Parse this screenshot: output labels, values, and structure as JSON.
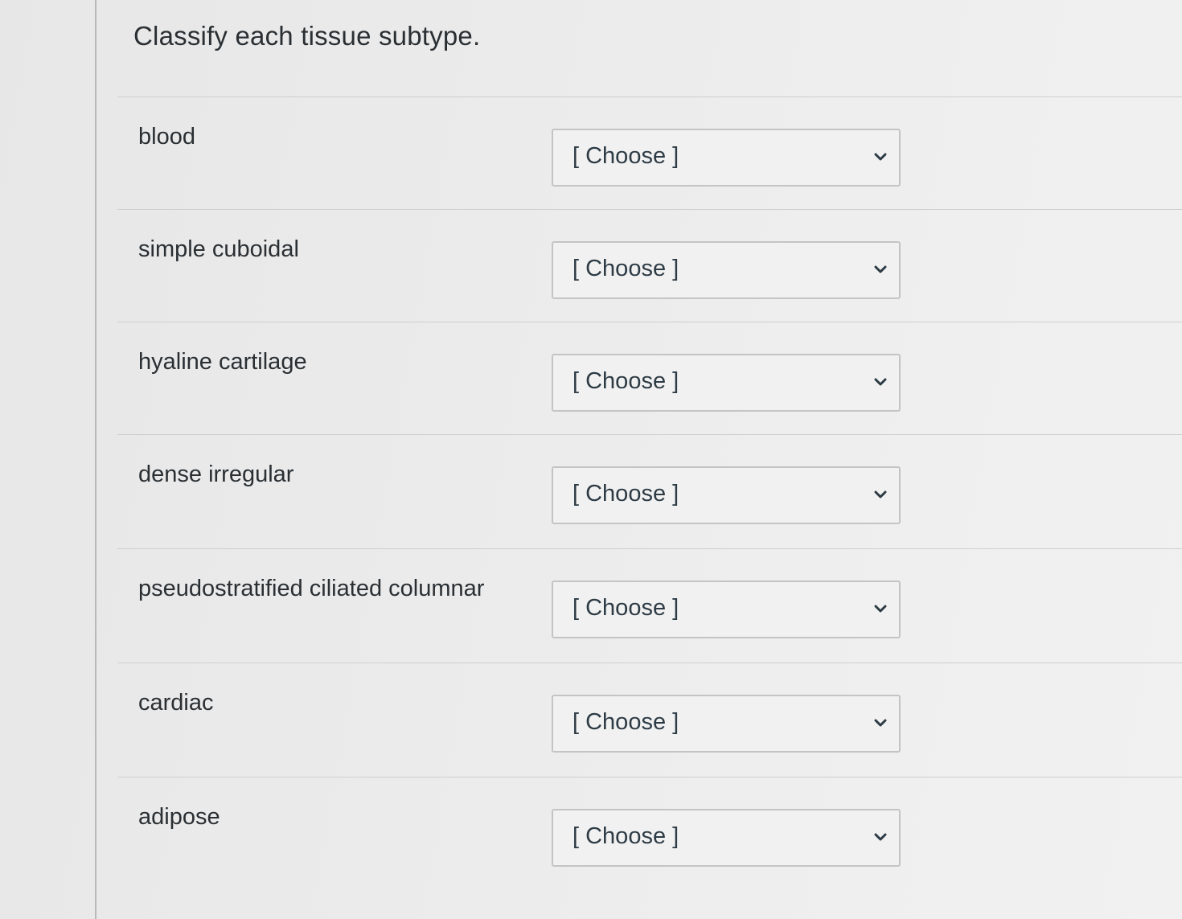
{
  "question": {
    "title": "Classify each tissue subtype."
  },
  "rows": [
    {
      "label": "blood",
      "selected": "[ Choose ]"
    },
    {
      "label": "simple cuboidal",
      "selected": "[ Choose ]"
    },
    {
      "label": "hyaline cartilage",
      "selected": "[ Choose ]"
    },
    {
      "label": "dense irregular",
      "selected": "[ Choose ]"
    },
    {
      "label": "pseudostratified ciliated columnar",
      "selected": "[ Choose ]"
    },
    {
      "label": "cardiac",
      "selected": "[ Choose ]"
    },
    {
      "label": "adipose",
      "selected": "[ Choose ]"
    }
  ],
  "icons": {
    "dropdown": "chevron-down-icon"
  },
  "colors": {
    "text": "#2d3b45",
    "border": "#c4c4c4",
    "divider": "#cfcfcf"
  }
}
